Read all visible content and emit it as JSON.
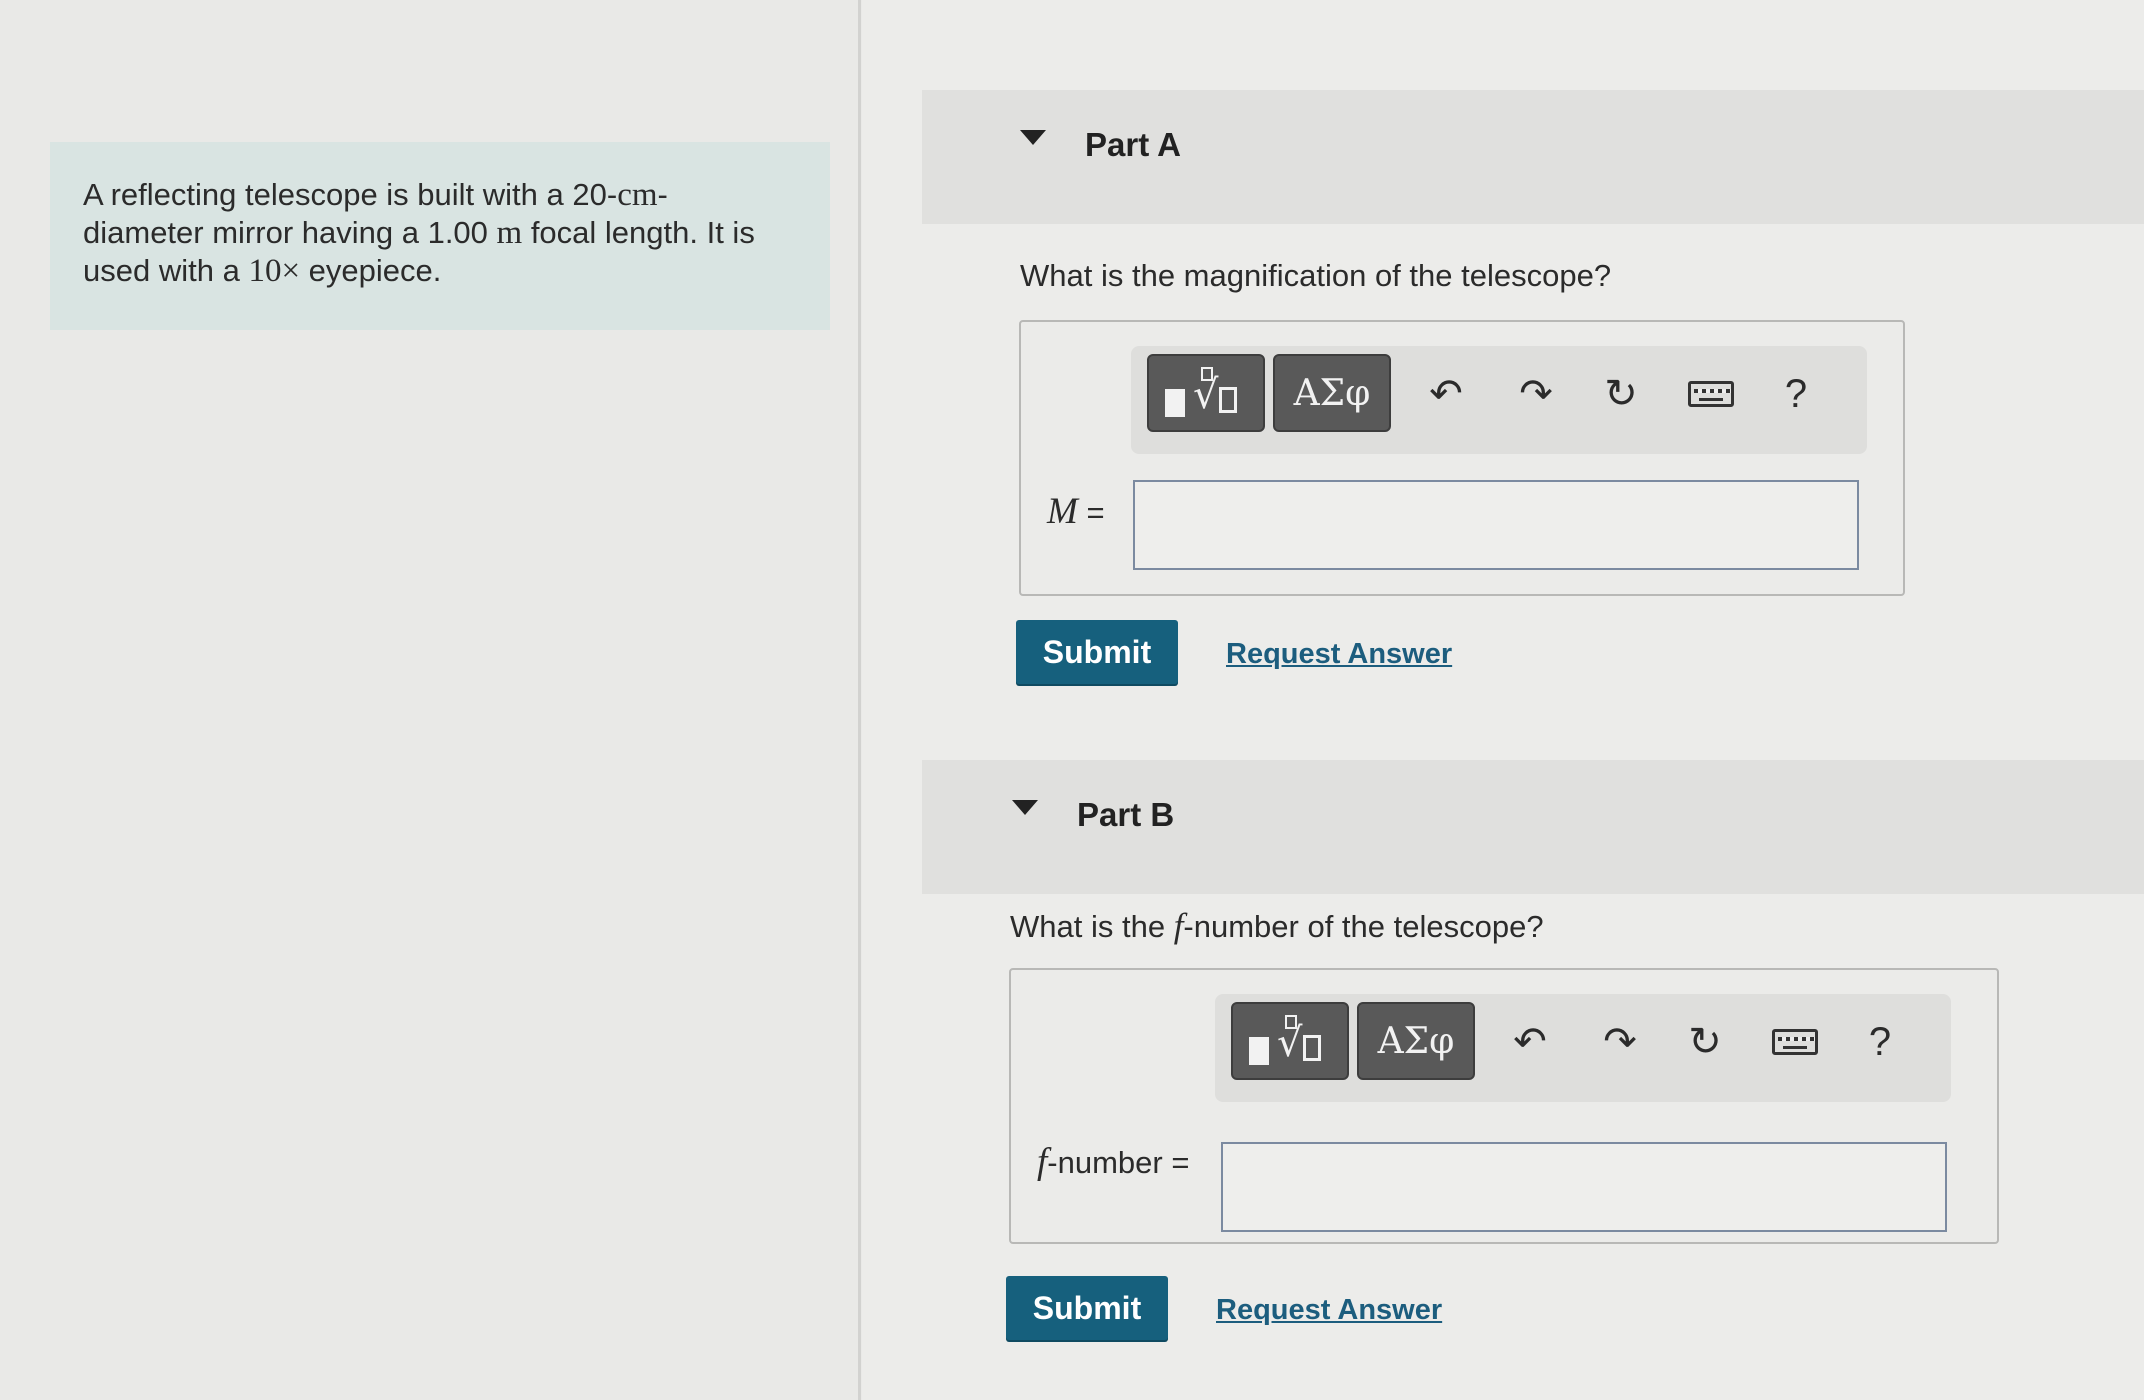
{
  "problem": {
    "text_before_1": "A reflecting telescope is built with a 20-",
    "unit_cm": "cm",
    "text_after_1": "- diameter mirror having a 1.00 ",
    "unit_m": "m",
    "text_after_2": " focal length. It is used with a ",
    "mag_value": "10×",
    "text_after_3": " eyepiece."
  },
  "part_a": {
    "title": "Part A",
    "question": "What is the magnification of the telescope?",
    "toolbar": {
      "greek_label": "ΑΣφ",
      "help_label": "?",
      "icons": [
        "templates-icon",
        "greek-letters-icon",
        "undo-icon",
        "redo-icon",
        "reset-icon",
        "keyboard-icon",
        "help-icon"
      ]
    },
    "answer_var": "M",
    "answer_eq": " =",
    "input_value": "",
    "submit_label": "Submit",
    "request_label": "Request Answer"
  },
  "part_b": {
    "title": "Part B",
    "question_before": "What is the ",
    "question_var": "f",
    "question_after": "-number of the telescope?",
    "toolbar": {
      "greek_label": "ΑΣφ",
      "help_label": "?",
      "icons": [
        "templates-icon",
        "greek-letters-icon",
        "undo-icon",
        "redo-icon",
        "reset-icon",
        "keyboard-icon",
        "help-icon"
      ]
    },
    "answer_var": "f",
    "answer_suffix": "-number =",
    "input_value": "",
    "submit_label": "Submit",
    "request_label": "Request Answer"
  },
  "colors": {
    "submit_bg": "#16607d",
    "link": "#1c5d7e",
    "problem_bg": "#d9e4e2"
  }
}
